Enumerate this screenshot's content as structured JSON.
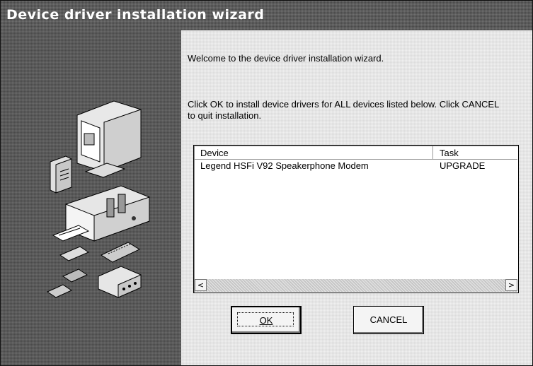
{
  "window": {
    "title": "Device driver installation wizard"
  },
  "content": {
    "welcome": "Welcome to the device driver installation wizard.",
    "instructions": "Click OK to install device drivers for ALL devices listed below. Click CANCEL to quit installation."
  },
  "device_list": {
    "columns": [
      "Device",
      "Task"
    ],
    "rows": [
      {
        "device": "Legend HSFi V92 Speakerphone Modem",
        "task": "UPGRADE"
      }
    ],
    "scroll_left_glyph": "<",
    "scroll_right_glyph": ">"
  },
  "buttons": {
    "ok_label": "OK",
    "cancel_label": "CANCEL"
  },
  "illustration": {
    "icons": [
      "computer-monitor-icon",
      "speaker-icon",
      "computer-case-icon",
      "expansion-card-icon",
      "network-hub-icon"
    ]
  }
}
